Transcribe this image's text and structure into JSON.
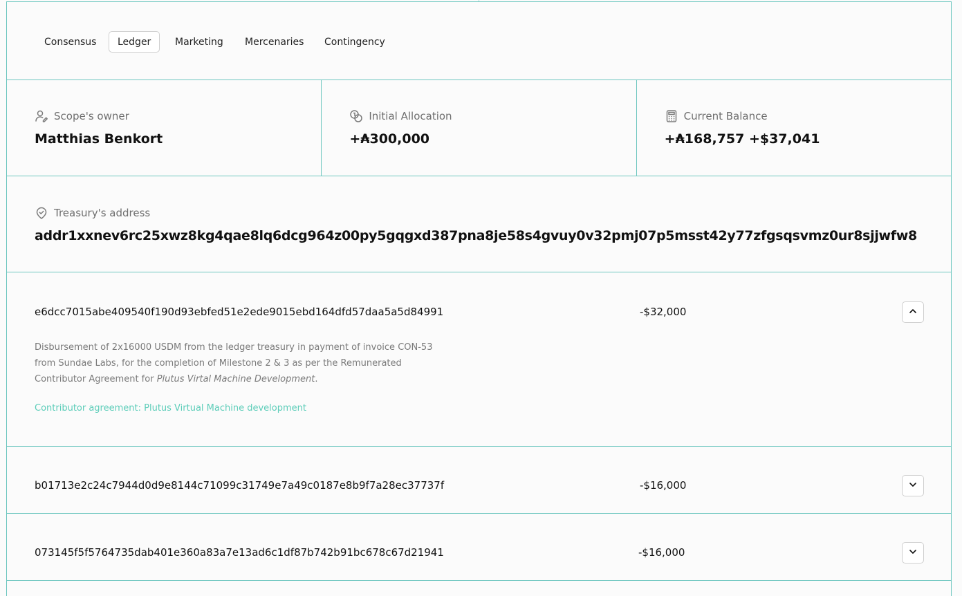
{
  "tabs": [
    {
      "label": "Consensus",
      "active": false
    },
    {
      "label": "Ledger",
      "active": true
    },
    {
      "label": "Marketing",
      "active": false
    },
    {
      "label": "Mercenaries",
      "active": false
    },
    {
      "label": "Contingency",
      "active": false
    }
  ],
  "stats": {
    "owner": {
      "label": "Scope's owner",
      "value": "Matthias Benkort",
      "icon": "user-icon"
    },
    "allocation": {
      "label": "Initial Allocation",
      "value": "+₳300,000",
      "icon": "coins-icon"
    },
    "balance": {
      "label": "Current Balance",
      "value": "+₳168,757 +$37,041",
      "icon": "calculator-icon"
    }
  },
  "treasury": {
    "label": "Treasury's address",
    "value": "addr1xxnev6rc25xwz8kg4qae8lq6dcg964z00py5gqgxd387pna8je58s4gvuy0v32pmj07p5msst42y77zfgsqsvmz0ur8sjjwfw8",
    "icon": "badge-check-icon"
  },
  "transactions": [
    {
      "hash": "e6dcc7015abe409540f190d93ebfed51e2ede9015ebd164dfd57daa5a5d84991",
      "amount": "-$32,000",
      "expanded": true,
      "description_before": "Disbursement of 2x16000 USDM from the ledger treasury in payment of invoice CON-53 from Sundae Labs, for the completion of Milestone 2 & 3 as per the Remunerated Contributor Agreement for ",
      "description_emphasis": "Plutus Virtal Machine Development",
      "description_after": ".",
      "link": "Contributor agreement: Plutus Virtual Machine development"
    },
    {
      "hash": "b01713e2c24c7944d0d9e8144c71099c31749e7a49c0187e8b9f7a28ec37737f",
      "amount": "-$16,000",
      "expanded": false
    },
    {
      "hash": "073145f5f5764735dab401e360a83a7e13ad6c1df87b742b91bc678c67d21941",
      "amount": "-$16,000",
      "expanded": false
    }
  ],
  "colors": {
    "border": "#6cc6bf",
    "link": "#5ccdb9",
    "muted_text": "#7a7a7a"
  }
}
